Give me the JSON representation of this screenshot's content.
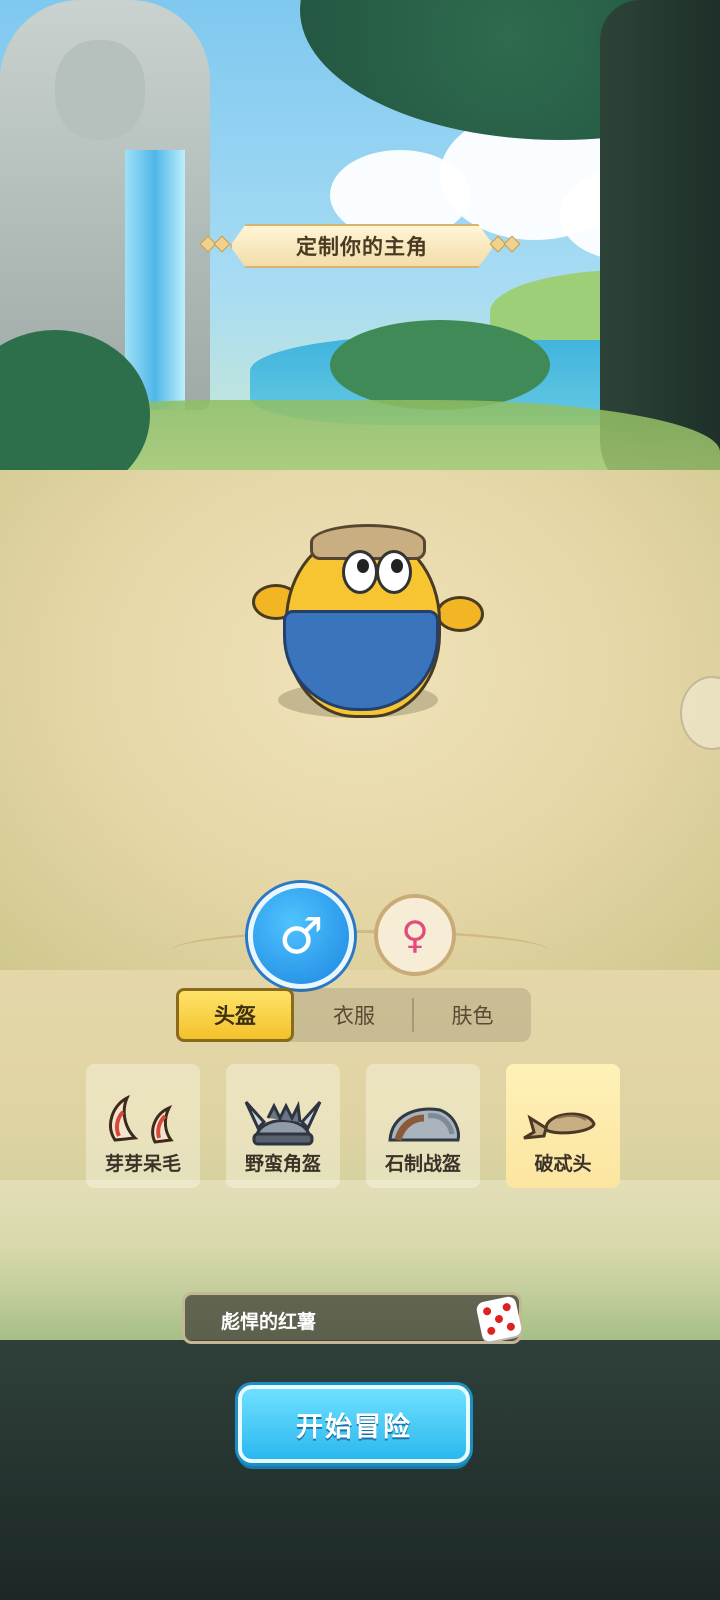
{
  "title": "定制你的主角",
  "gender": {
    "male_symbol": "♂",
    "female_symbol": "♀",
    "selected": "male"
  },
  "tabs": [
    {
      "label": "头盔",
      "active": true
    },
    {
      "label": "衣服",
      "active": false
    },
    {
      "label": "肤色",
      "active": false
    }
  ],
  "items": [
    {
      "label": "芽芽呆毛",
      "icon": "sprout-hair-icon",
      "selected": false
    },
    {
      "label": "野蛮角盔",
      "icon": "horned-helmet-icon",
      "selected": false
    },
    {
      "label": "石制战盔",
      "icon": "stone-helmet-icon",
      "selected": false
    },
    {
      "label": "破忒头",
      "icon": "bandana-icon",
      "selected": true
    }
  ],
  "name_field": {
    "value": "彪悍的红薯",
    "randomize_icon": "dice-icon"
  },
  "start_button": "开始冒险",
  "colors": {
    "accent_blue": "#2bb8ef",
    "tab_active": "#f4c22b",
    "female_pink": "#e24b7c"
  }
}
